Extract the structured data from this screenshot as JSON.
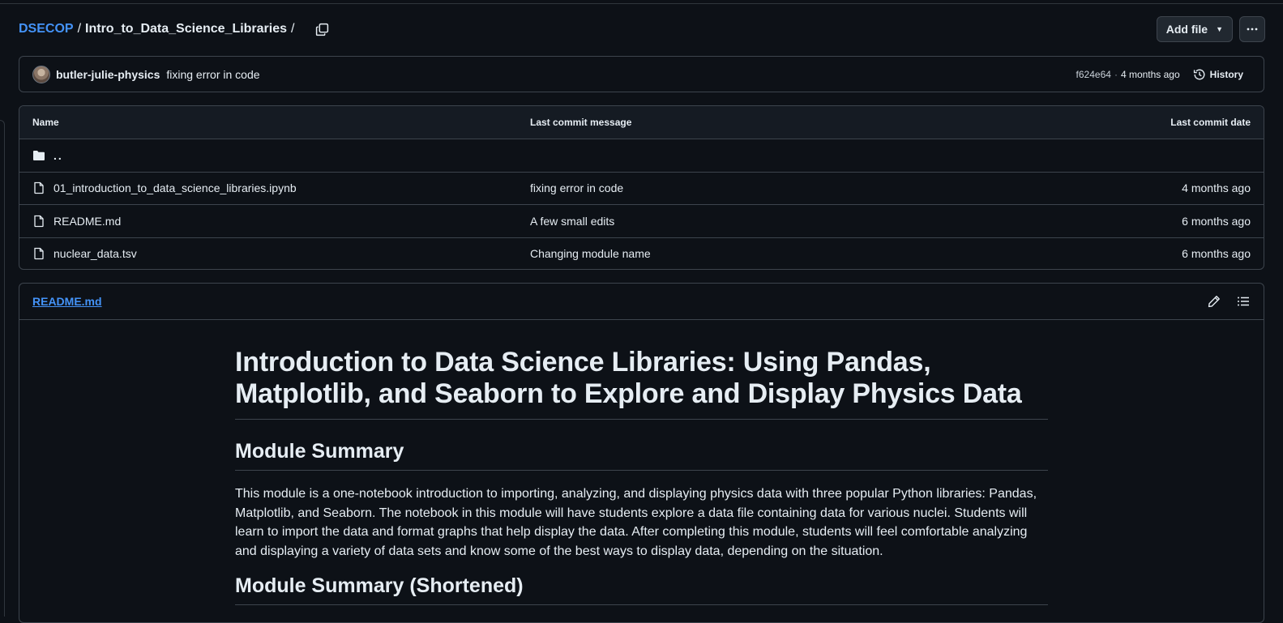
{
  "breadcrumb": {
    "owner": "DSECOP",
    "separator": "/",
    "folder": "Intro_to_Data_Science_Libraries",
    "trailing_separator": "/"
  },
  "header_actions": {
    "add_file_label": "Add file",
    "more_label": "..."
  },
  "commit": {
    "author": "butler-julie-physics",
    "message": "fixing error in code",
    "sha": "f624e64",
    "separator": "·",
    "age": "4 months ago",
    "history_label": "History"
  },
  "table": {
    "headers": {
      "name": "Name",
      "message": "Last commit message",
      "date": "Last commit date"
    },
    "parent_dir": "..",
    "files": [
      {
        "name": "01_introduction_to_data_science_libraries.ipynb",
        "message": "fixing error in code",
        "date": "4 months ago"
      },
      {
        "name": "README.md",
        "message": "A few small edits",
        "date": "6 months ago"
      },
      {
        "name": "nuclear_data.tsv",
        "message": "Changing module name",
        "date": "6 months ago"
      }
    ]
  },
  "readme": {
    "filename": "README.md",
    "title": "Introduction to Data Science Libraries: Using Pandas, Matplotlib, and Seaborn to Explore and Display Physics Data",
    "section1_heading": "Module Summary",
    "section1_text": "This module is a one-notebook introduction to importing, analyzing, and displaying physics data with three popular Python libraries: Pandas, Matplotlib, and Seaborn. The notebook in this module will have students explore a data file containing data for various nuclei. Students will learn to import the data and format graphs that help display the data. After completing this module, students will feel comfortable analyzing and displaying a variety of data sets and know some of the best ways to display data, depending on the situation.",
    "section2_heading": "Module Summary (Shortened)"
  },
  "colors": {
    "background": "#0d1117",
    "link": "#4493f8",
    "border": "#3d444d",
    "text": "#e6edf3"
  }
}
